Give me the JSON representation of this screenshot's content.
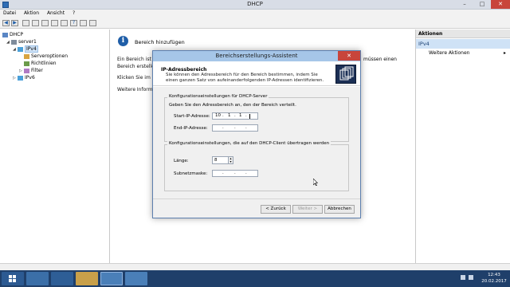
{
  "window": {
    "title": "DHCP",
    "minimize": "–",
    "maximize": "□",
    "close": "✕"
  },
  "menu": [
    "Datei",
    "Aktion",
    "Ansicht",
    "?"
  ],
  "tree": {
    "root": "DHCP",
    "server": "server1",
    "ipv4": "IPv4",
    "children": [
      "Serveroptionen",
      "Richtlinien",
      "Filter"
    ],
    "ipv6": "IPv6"
  },
  "middle": {
    "heading": "Bereich hinzufügen",
    "line1": "Ein Bereich ist e",
    "line2": "Bereich erstelle",
    "line3": "Klicken Sie im N",
    "line4": "Weitere Informa",
    "line1_right": "müssen einen"
  },
  "actions": {
    "header": "Aktionen",
    "section": "IPv4",
    "item": "Weitere Aktionen",
    "arrow": "▸"
  },
  "dialog": {
    "title": "Bereichserstellungs-Assistent",
    "close": "✕",
    "header_title": "IP-Adressbereich",
    "header_sub": "Sie können den Adressbereich für den Bereich bestimmen, indem Sie einen ganzen Satz von aufeinanderfolgenden IP-Adressen identifizieren.",
    "group1_label": "Konfigurationseinstellungen für DHCP-Server",
    "group1_desc": "Geben Sie den Adressbereich an, den der Bereich verteilt.",
    "start_label": "Start-IP-Adresse:",
    "start_value": [
      "10",
      "1",
      "1",
      ""
    ],
    "end_label": "End-IP-Adresse:",
    "end_value": [
      "",
      "",
      "",
      ""
    ],
    "group2_label": "Konfigurationseinstellungen, die auf den DHCP-Client übertragen werden",
    "length_label": "Länge:",
    "length_value": "8",
    "subnet_label": "Subnetzmaske:",
    "subnet_value": [
      "",
      "",
      "",
      ""
    ],
    "back": "< Zurück",
    "next": "Weiter >",
    "cancel": "Abbrechen"
  },
  "clock": {
    "time": "12:43",
    "date": "20.02.2017"
  },
  "colors": {
    "accent": "#1f5ea8",
    "close": "#c8453b",
    "dialog_title": "#a6c6e8",
    "taskbar": "#1f3f6a"
  }
}
